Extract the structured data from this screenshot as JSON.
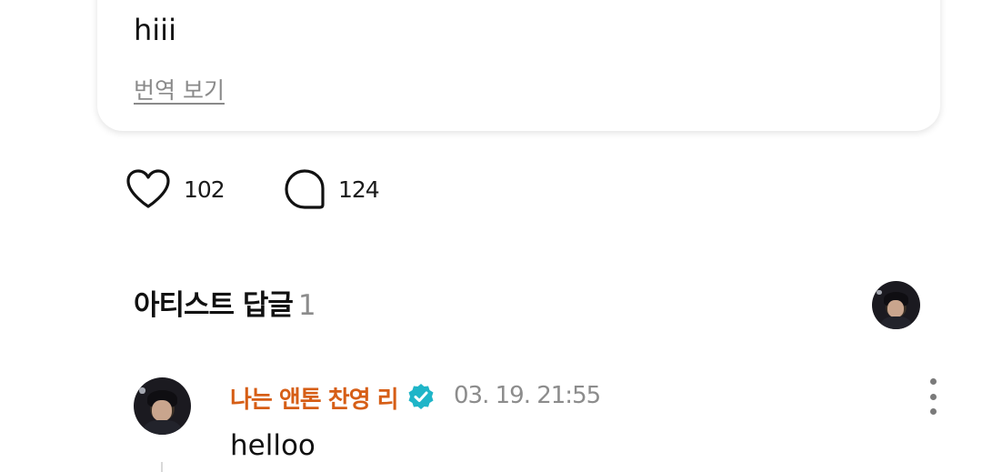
{
  "post": {
    "text": "hiii",
    "translate_label": "번역 보기"
  },
  "actions": {
    "like_count": "102",
    "comment_count": "124"
  },
  "artist_replies": {
    "title": "아티스트 답글",
    "count": "1"
  },
  "comment": {
    "author": "나는 앤톤 찬영 리",
    "time": "03. 19. 21:55",
    "text": "helloo",
    "verified_icon": "verified-badge-icon",
    "more_icon": "more-vertical-icon"
  },
  "colors": {
    "author": "#d65e16",
    "verified": "#1fb5c8",
    "muted": "#8c8c8c"
  }
}
